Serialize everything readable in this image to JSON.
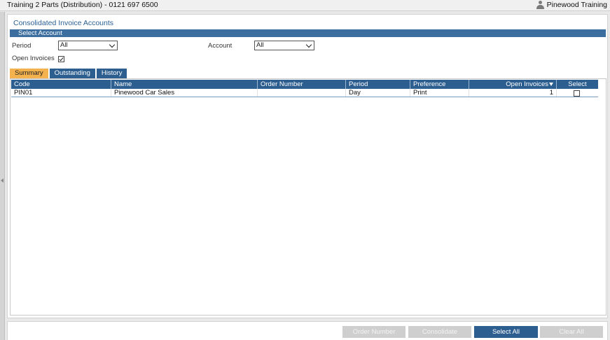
{
  "window": {
    "title": "Training 2 Parts (Distribution) - 0121 697 6500",
    "user": "Pinewood Training"
  },
  "panel": {
    "title": "Consolidated Invoice Accounts",
    "section": "Select Account"
  },
  "filters": {
    "period_label": "Period",
    "period_value": "All",
    "account_label": "Account",
    "account_value": "All",
    "open_invoices_label": "Open Invoices",
    "open_invoices_checked": true
  },
  "tabs": [
    {
      "label": "Summary",
      "active": true
    },
    {
      "label": "Outstanding",
      "active": false
    },
    {
      "label": "History",
      "active": false
    }
  ],
  "grid": {
    "columns": [
      "Code",
      "Name",
      "Order Number",
      "Period",
      "Preference",
      "Open Invoices",
      "Select"
    ],
    "sort_column": "Open Invoices",
    "sort_direction": "descending",
    "rows": [
      {
        "code": "PIN01",
        "name": "Pinewood Car Sales",
        "order_number": "",
        "period": "Day",
        "preference": "Print",
        "open_invoices": "1",
        "selected": false
      }
    ]
  },
  "buttons": {
    "order_number": "Order Number",
    "consolidate": "Consolidate",
    "select_all": "Select All",
    "clear_all": "Clear All"
  },
  "colors": {
    "header_blue": "#2d5e90",
    "active_tab": "#f4b24f",
    "disabled_button": "#cfcfcf"
  }
}
